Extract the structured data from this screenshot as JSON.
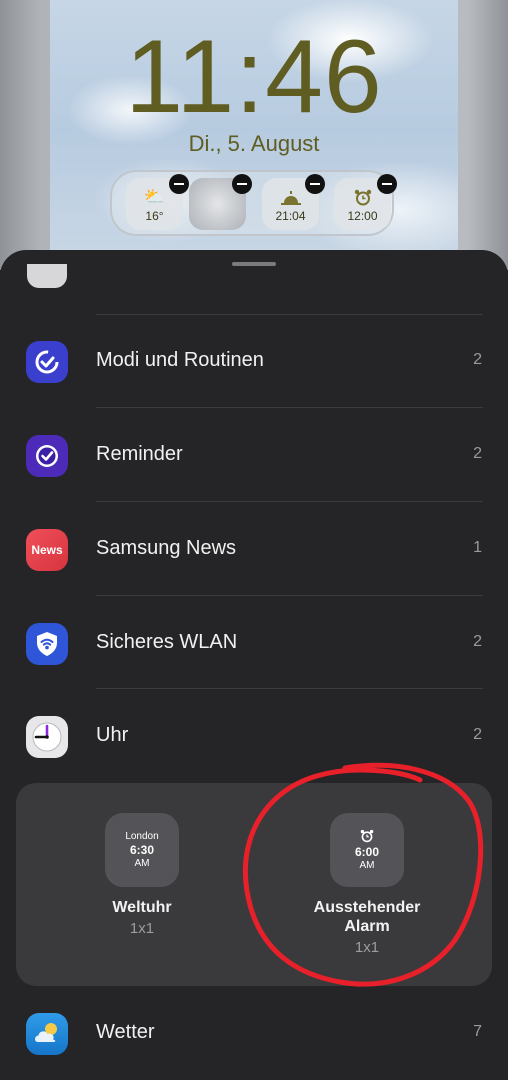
{
  "lockscreen": {
    "time": "11:46",
    "date": "Di., 5. August",
    "widgets": [
      {
        "icon": "weather-cloud-sun-icon",
        "label": "16°"
      },
      {
        "icon": "moon-phase-icon",
        "label": ""
      },
      {
        "icon": "sunset-icon",
        "label": "21:04"
      },
      {
        "icon": "alarm-clock-icon",
        "label": "12:00"
      }
    ]
  },
  "apps": [
    {
      "name": "Modi und Routinen",
      "count": "2",
      "icon": "modes-routines-icon",
      "color": "#3b3fce"
    },
    {
      "name": "Reminder",
      "count": "2",
      "icon": "reminder-check-icon",
      "color": "#4b2bb8"
    },
    {
      "name": "Samsung News",
      "count": "1",
      "icon": "news-icon",
      "color": "#e2424a",
      "icon_text": "News"
    },
    {
      "name": "Sicheres WLAN",
      "count": "2",
      "icon": "secure-wifi-shield-icon",
      "color": "#2f56d8"
    },
    {
      "name": "Uhr",
      "count": "2",
      "icon": "clock-icon",
      "color": "#e7e7ea"
    },
    {
      "name": "Wetter",
      "count": "7",
      "icon": "weather-icon",
      "color": "#1d8ad8"
    }
  ],
  "clock_widgets": [
    {
      "name": "Weltuhr",
      "size": "1x1",
      "preview": {
        "city": "London",
        "time": "6:30",
        "ampm": "AM"
      }
    },
    {
      "name": "Ausstehender Alarm",
      "size": "1x1",
      "preview": {
        "icon": "alarm-clock-icon",
        "time": "6:00",
        "ampm": "AM"
      }
    }
  ],
  "annotation": {
    "color": "#e8202a"
  }
}
